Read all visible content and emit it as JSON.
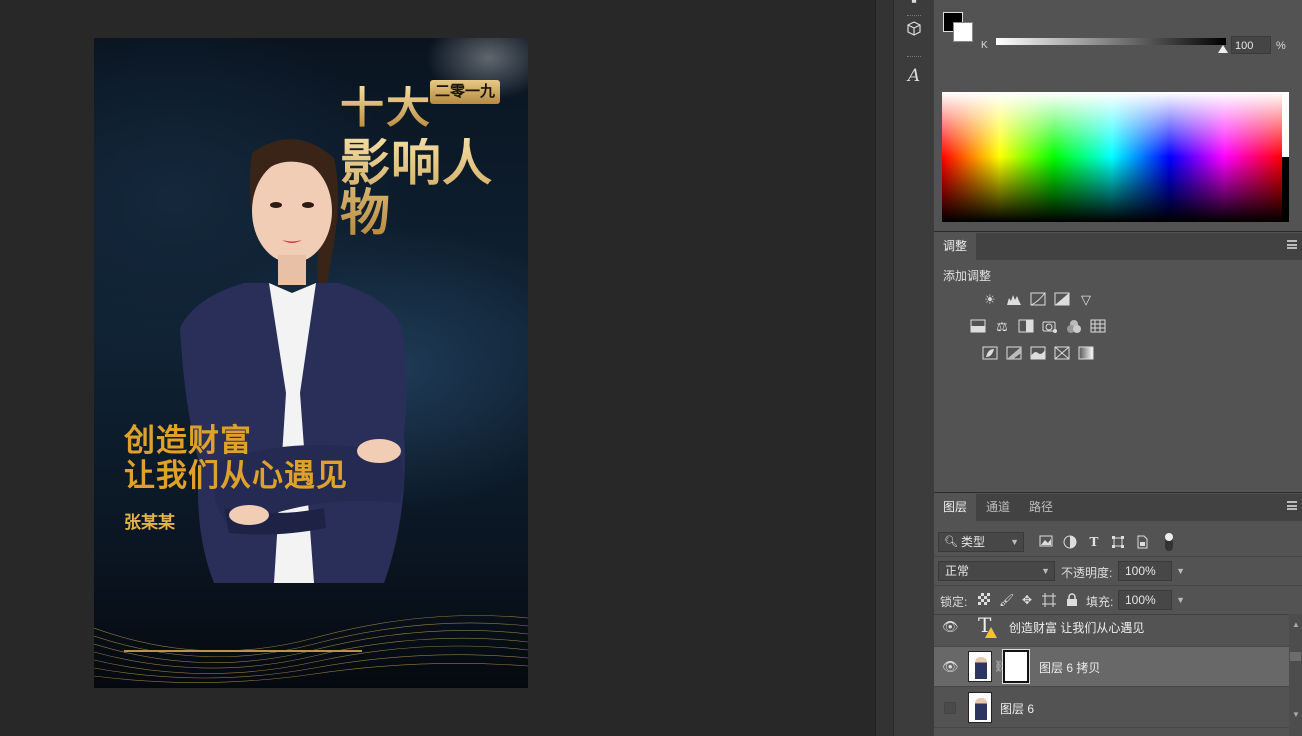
{
  "poster": {
    "year_badge": "二零一九",
    "title_line1": "十大",
    "title_line2": "影响人物",
    "slogan_line1": "创造财富",
    "slogan_line2": "让我们从心遇见",
    "person_name": "张某某"
  },
  "tools": {
    "icons": [
      "3d-object-icon",
      "character-type-icon"
    ],
    "type_glyph": "A"
  },
  "color_panel": {
    "channel_label": "K",
    "value": "100",
    "unit": "%",
    "foreground_color": "#000000",
    "background_color": "#ffffff"
  },
  "adjustments_panel": {
    "tab_label": "调整",
    "add_label": "添加调整",
    "rows": [
      [
        "brightness-contrast-icon",
        "levels-icon",
        "curves-icon",
        "exposure-icon",
        "vibrance-icon"
      ],
      [
        "hue-saturation-icon",
        "color-balance-icon",
        "black-white-icon",
        "photo-filter-icon",
        "channel-mixer-icon",
        "color-lookup-icon"
      ],
      [
        "invert-icon",
        "posterize-icon",
        "threshold-icon",
        "selective-color-icon",
        "gradient-map-icon"
      ]
    ]
  },
  "layers_panel": {
    "tabs": [
      "图层",
      "通道",
      "路径"
    ],
    "active_tab": "图层",
    "filter_label": "类型",
    "blend_mode": "正常",
    "opacity_label": "不透明度:",
    "opacity_value": "100%",
    "lock_label": "锁定:",
    "fill_label": "填充:",
    "fill_value": "100%",
    "layers": [
      {
        "name": "创造财富 让我们从心遇见",
        "kind": "text",
        "visible": true,
        "selected": false
      },
      {
        "name": "图层 6 拷贝",
        "kind": "pixel-masked",
        "visible": true,
        "selected": true
      },
      {
        "name": "图层 6",
        "kind": "pixel",
        "visible": false,
        "selected": false
      }
    ]
  }
}
